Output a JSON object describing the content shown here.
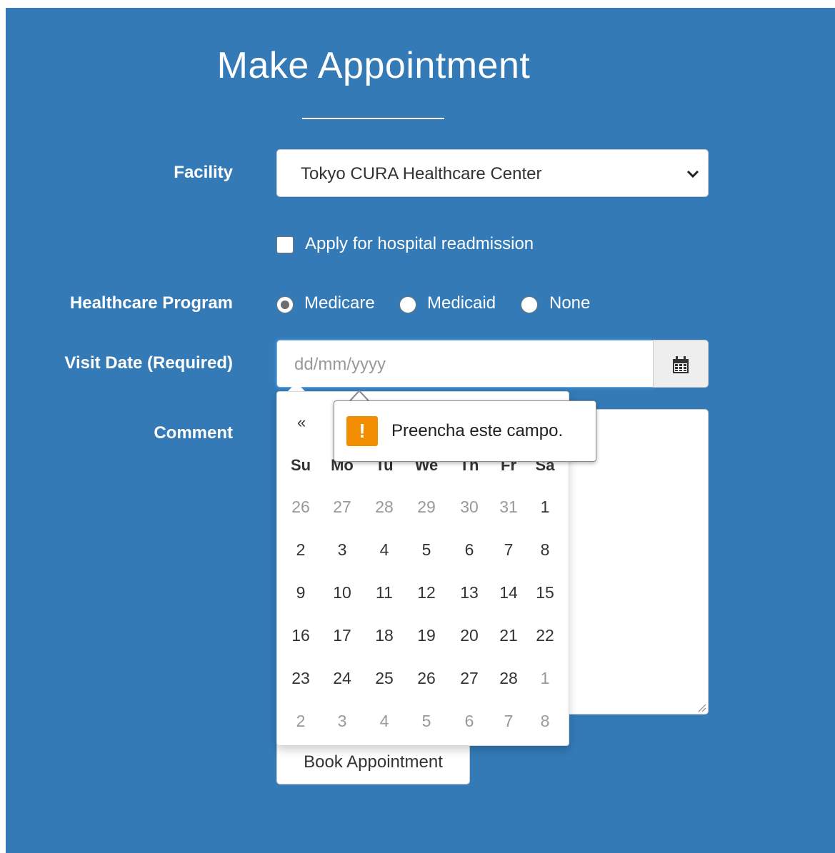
{
  "page": {
    "title": "Make Appointment"
  },
  "form": {
    "facility_label": "Facility",
    "facility_value": "Tokyo CURA Healthcare Center",
    "readmission_label": "Apply for hospital readmission",
    "readmission_checked": false,
    "program_label": "Healthcare Program",
    "programs": [
      {
        "label": "Medicare",
        "checked": true
      },
      {
        "label": "Medicaid",
        "checked": false
      },
      {
        "label": "None",
        "checked": false
      }
    ],
    "visit_date_label": "Visit Date (Required)",
    "visit_date_placeholder": "dd/mm/yyyy",
    "comment_label": "Comment",
    "submit_label": "Book Appointment"
  },
  "datepicker": {
    "prev_label": "«",
    "weekdays": [
      "Su",
      "Mo",
      "Tu",
      "We",
      "Th",
      "Fr",
      "Sa"
    ],
    "weeks": [
      [
        {
          "d": "26",
          "m": true
        },
        {
          "d": "27",
          "m": true
        },
        {
          "d": "28",
          "m": true
        },
        {
          "d": "29",
          "m": true
        },
        {
          "d": "30",
          "m": true
        },
        {
          "d": "31",
          "m": true
        },
        {
          "d": "1",
          "m": false
        }
      ],
      [
        {
          "d": "2",
          "m": false
        },
        {
          "d": "3",
          "m": false
        },
        {
          "d": "4",
          "m": false
        },
        {
          "d": "5",
          "m": false
        },
        {
          "d": "6",
          "m": false
        },
        {
          "d": "7",
          "m": false
        },
        {
          "d": "8",
          "m": false
        }
      ],
      [
        {
          "d": "9",
          "m": false
        },
        {
          "d": "10",
          "m": false
        },
        {
          "d": "11",
          "m": false
        },
        {
          "d": "12",
          "m": false
        },
        {
          "d": "13",
          "m": false
        },
        {
          "d": "14",
          "m": false
        },
        {
          "d": "15",
          "m": false
        }
      ],
      [
        {
          "d": "16",
          "m": false
        },
        {
          "d": "17",
          "m": false
        },
        {
          "d": "18",
          "m": false
        },
        {
          "d": "19",
          "m": false
        },
        {
          "d": "20",
          "m": false
        },
        {
          "d": "21",
          "m": false
        },
        {
          "d": "22",
          "m": false
        }
      ],
      [
        {
          "d": "23",
          "m": false
        },
        {
          "d": "24",
          "m": false
        },
        {
          "d": "25",
          "m": false
        },
        {
          "d": "26",
          "m": false
        },
        {
          "d": "27",
          "m": false
        },
        {
          "d": "28",
          "m": false
        },
        {
          "d": "1",
          "m": true
        }
      ],
      [
        {
          "d": "2",
          "m": true
        },
        {
          "d": "3",
          "m": true
        },
        {
          "d": "4",
          "m": true
        },
        {
          "d": "5",
          "m": true
        },
        {
          "d": "6",
          "m": true
        },
        {
          "d": "7",
          "m": true
        },
        {
          "d": "8",
          "m": true
        }
      ]
    ]
  },
  "validation": {
    "icon": "warning-icon",
    "icon_glyph": "!",
    "message": "Preencha este campo."
  },
  "colors": {
    "background": "#337ab7",
    "warning": "#f28c00",
    "muted_day": "#999999"
  }
}
